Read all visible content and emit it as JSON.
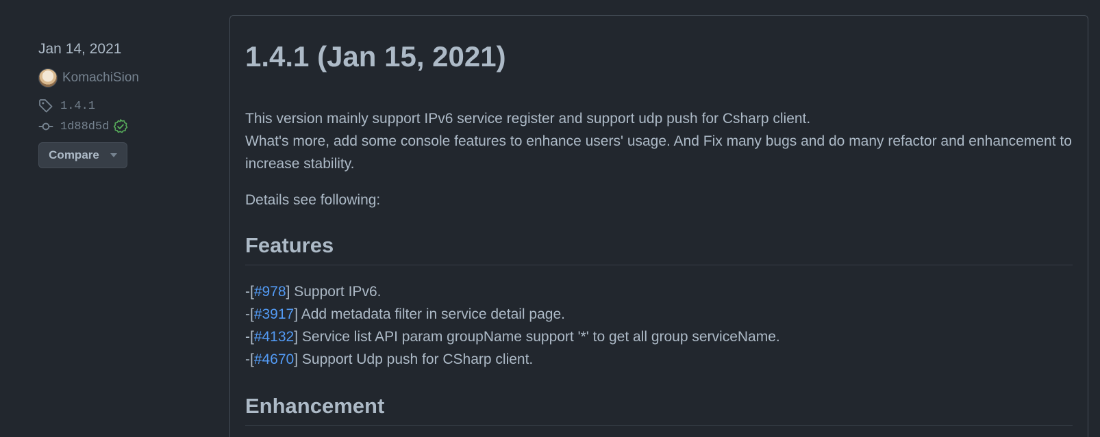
{
  "sidebar": {
    "date": "Jan 14, 2021",
    "author": "KomachiSion",
    "tag": "1.4.1",
    "commit": "1d88d5d",
    "compare_label": "Compare"
  },
  "release": {
    "title": "1.4.1 (Jan 15, 2021)",
    "intro_line1": "This version mainly support IPv6 service register and support udp push for Csharp client.",
    "intro_line2": "What's more, add some console features to enhance users' usage. And Fix many bugs and do many refactor and enhancement to increase stability.",
    "details": "Details see following:",
    "features_heading": "Features",
    "features": [
      {
        "prefix": "-[",
        "issue": "#978",
        "text": "] Support IPv6."
      },
      {
        "prefix": "-[",
        "issue": "#3917",
        "text": "] Add metadata filter in service detail page."
      },
      {
        "prefix": "-[",
        "issue": "#4132",
        "text": "] Service list API param groupName support '*' to get all group serviceName."
      },
      {
        "prefix": "-[",
        "issue": "#4670",
        "text": "] Support Udp push for CSharp client."
      }
    ],
    "enhancement_heading": "Enhancement"
  },
  "colors": {
    "background": "#22272e",
    "text": "#adbac7",
    "muted": "#768390",
    "link": "#539bf5",
    "verified": "#57ab5a",
    "border": "#444c56"
  },
  "icons": {
    "tag": "tag-icon",
    "commit": "git-commit-icon",
    "verified": "verified-check-icon",
    "caret": "triangle-down-icon"
  }
}
